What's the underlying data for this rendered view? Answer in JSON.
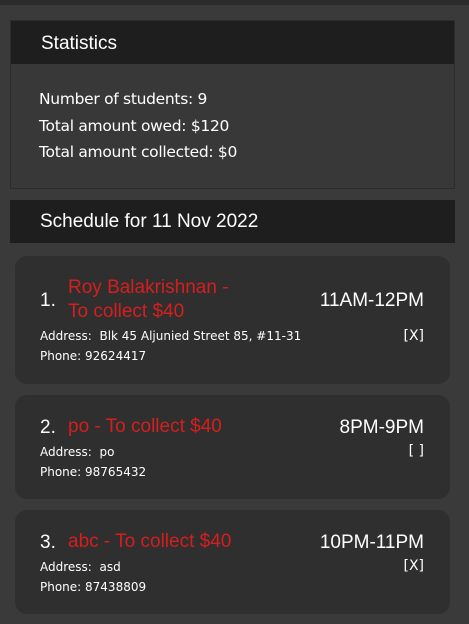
{
  "statistics": {
    "title": "Statistics",
    "students": "Number of students: 9",
    "owed": "Total amount owed: $120",
    "collected": "Total amount collected: $0"
  },
  "schedule": {
    "title": "Schedule for 11 Nov 2022",
    "entries": [
      {
        "index": "1.",
        "name_line1": "Roy Balakrishnan -",
        "name_line2": "To collect $40",
        "time": "11AM-12PM",
        "mark": "[X]",
        "address": "Address:  Blk 45 Aljunied Street 85, #11-31",
        "phone": "Phone: 92624417"
      },
      {
        "index": "2.",
        "name_line1": "po - To collect $40",
        "time": "8PM-9PM",
        "mark": "[ ]",
        "address": "Address:  po",
        "phone": "Phone: 98765432"
      },
      {
        "index": "3.",
        "name_line1": "abc - To collect $40",
        "time": "10PM-11PM",
        "mark": "[X]",
        "address": "Address:  asd",
        "phone": "Phone: 87438809"
      }
    ]
  },
  "colors": {
    "background": "#3a3a3a",
    "header": "#1e1e1e",
    "card": "#2f2f2f",
    "name_accent": "#d61e1e"
  }
}
